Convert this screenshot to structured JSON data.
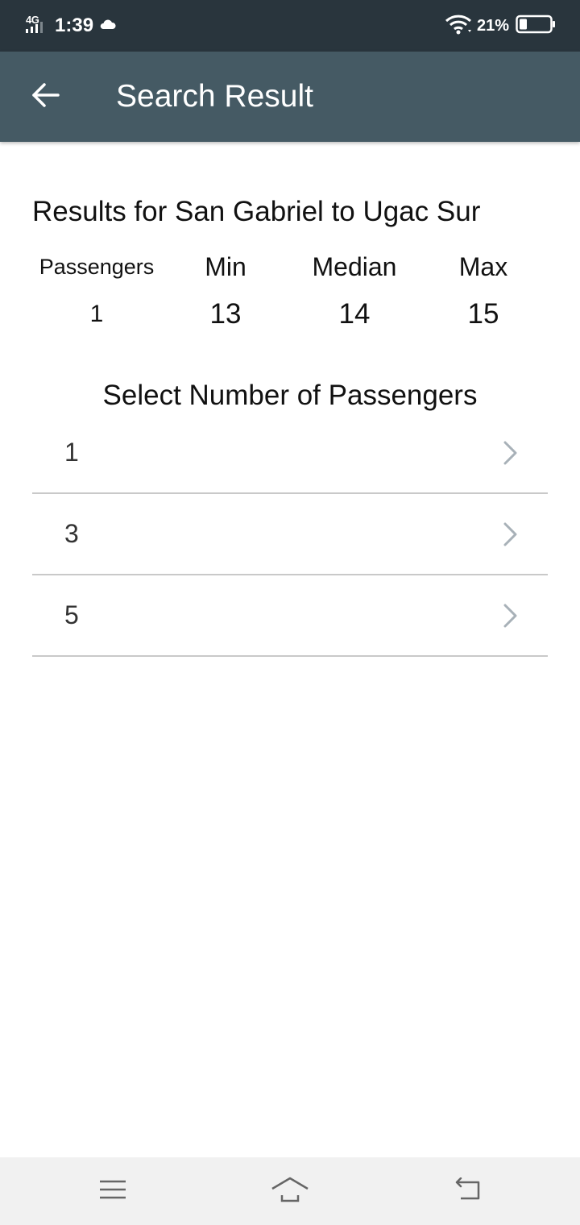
{
  "status_bar": {
    "network": "4G",
    "time": "1:39",
    "battery_percent": "21%",
    "icons": [
      "signal-icon",
      "cloud-icon",
      "wifi-icon",
      "battery-icon"
    ]
  },
  "app_bar": {
    "title": "Search Result",
    "back_icon": "arrow-left-icon"
  },
  "results": {
    "heading": "Results for San Gabriel to Ugac Sur",
    "columns": [
      "Passengers",
      "Min",
      "Median",
      "Max"
    ],
    "values": [
      "1",
      "13",
      "14",
      "15"
    ]
  },
  "passenger_select": {
    "heading": "Select Number of Passengers",
    "options": [
      "1",
      "3",
      "5"
    ],
    "item_icon": "chevron-right-icon"
  },
  "nav_bar": {
    "icons": [
      "menu-icon",
      "home-icon",
      "back-icon"
    ]
  },
  "colors": {
    "status_bar_bg": "#29353d",
    "app_bar_bg": "#455a64",
    "divider": "#c9c9c9",
    "chevron": "#a8b1b8",
    "nav_bar_bg": "#f1f1f1"
  }
}
